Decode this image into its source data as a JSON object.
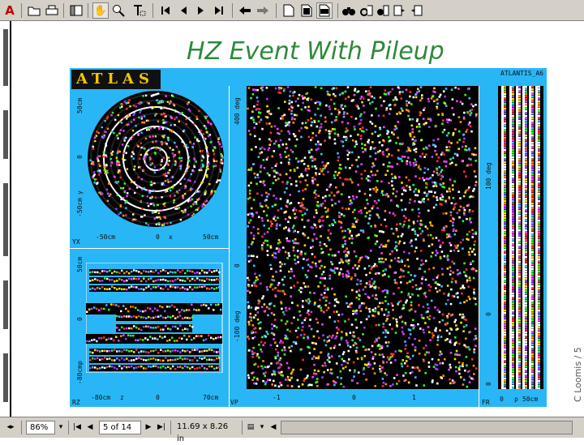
{
  "toolbar": {
    "icons": [
      "adobe-logo-icon",
      "open-icon",
      "print-icon",
      "show-hide-navigation-icon",
      "hand-tool-icon",
      "zoom-tool-icon",
      "text-select-tool-icon",
      "first-page-icon",
      "previous-page-icon",
      "next-page-icon",
      "last-page-icon",
      "go-back-icon",
      "go-forward-icon",
      "actual-size-icon",
      "fit-page-icon",
      "fit-width-icon",
      "find-icon",
      "search-icon",
      "search-results-icon",
      "next-highlight-icon",
      "previous-highlight-icon"
    ],
    "logo_glyph": "A"
  },
  "slide": {
    "title": "HZ Event With Pileup",
    "author": "C Loomis / 5"
  },
  "atlantis": {
    "logo": "ATLAS",
    "id_label": "ATLANTIS_A6",
    "yx": {
      "tag": "YX",
      "y_ticks": [
        "50cm",
        "0",
        "-50cm"
      ],
      "y_axis": "y",
      "x_ticks": [
        "-50cm",
        "0",
        "x",
        "50cm"
      ]
    },
    "rz": {
      "tag": "RZ",
      "y_ticks": [
        "50cm",
        "0",
        "-80cm"
      ],
      "y_axis": "ρ",
      "x_ticks": [
        "-80cm",
        "z",
        "0",
        "70cm"
      ]
    },
    "vp": {
      "tag": "VP",
      "y_ticks": [
        "400 deg",
        "0",
        "-100 deg"
      ],
      "x_ticks": [
        "-1",
        "0",
        "1"
      ]
    },
    "fr": {
      "tag": "FR",
      "y_ticks": [
        "100 deg",
        "0",
        "0"
      ],
      "x_ticks": [
        "0",
        "ρ",
        "50cm"
      ]
    }
  },
  "statusbar": {
    "zoom": "86%",
    "page": "5 of 14",
    "page_size": "11.69 x 8.26 in"
  },
  "colors": {
    "display_bg": "#29b6f6",
    "title_green": "#2d8a3a",
    "logo_yellow": "#f5c400"
  }
}
